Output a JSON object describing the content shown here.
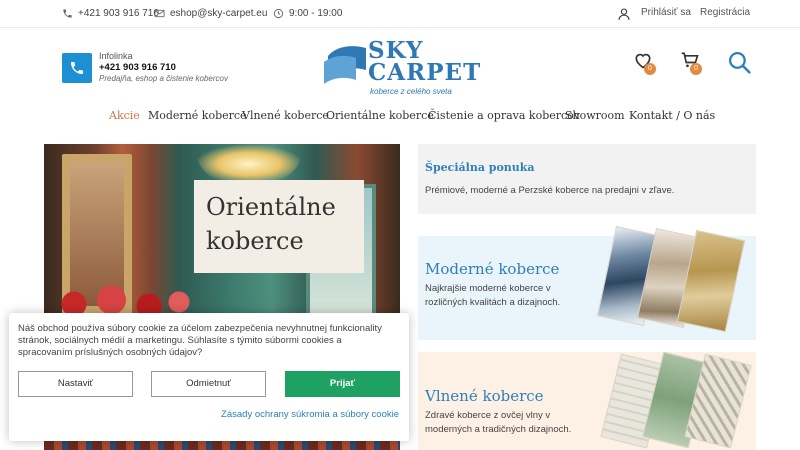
{
  "topbar": {
    "phone": "+421 903 916 710",
    "email": "eshop@sky-carpet.eu",
    "hours": "9:00 - 19:00",
    "login": "Prihlásiť sa",
    "register": "Registrácia"
  },
  "header": {
    "infoline_label": "Infolinka",
    "infoline_phone": "+421 903 916 710",
    "infoline_sub": "Predajňa, eshop a čistenie kobercov",
    "logo_line1": "SKY",
    "logo_line2": "CARPET",
    "logo_tagline": "koberce z celého sveta",
    "wishlist_count": "0",
    "cart_count": "0"
  },
  "nav": {
    "items": [
      {
        "label": "Akcie"
      },
      {
        "label": "Moderné koberce"
      },
      {
        "label": "Vlnené koberce"
      },
      {
        "label": "Orientálne koberce"
      },
      {
        "label": "Čistenie a oprava kobercov"
      },
      {
        "label": "Showroom"
      },
      {
        "label": "Kontakt / O nás"
      }
    ]
  },
  "hero": {
    "title_line1": "Orientálne",
    "title_line2": "koberce"
  },
  "cards": [
    {
      "title": "Špeciálna ponuka",
      "text": "Prémiové, moderné a Perzské koberce na predajni v zľave."
    },
    {
      "title": "Moderné koberce",
      "text": "Najkrajšie moderné koberce v rozličných kvalitách a dizajnoch."
    },
    {
      "title": "Vlnené koberce",
      "text": "Zdravé koberce z ovčej vlny v moderných a tradičných dizajnoch."
    }
  ],
  "cookie": {
    "text": "Náš obchod používa súbory cookie za účelom zabezpečenia nevyhnutnej funkcionality stránok, sociálnych médií a marketingu. Súhlasíte s týmito súbormi cookies a spracovaním príslušných osobných údajov?",
    "settings": "Nastaviť",
    "decline": "Odmietnuť",
    "accept": "Prijať",
    "policy_link": "Zásady ochrany súkromia a súbory cookie"
  },
  "colors": {
    "brand": "#2f78b6",
    "accent_orange": "#e48a3e",
    "accept_green": "#1fa163",
    "infoline_blue": "#1d8fd3"
  }
}
